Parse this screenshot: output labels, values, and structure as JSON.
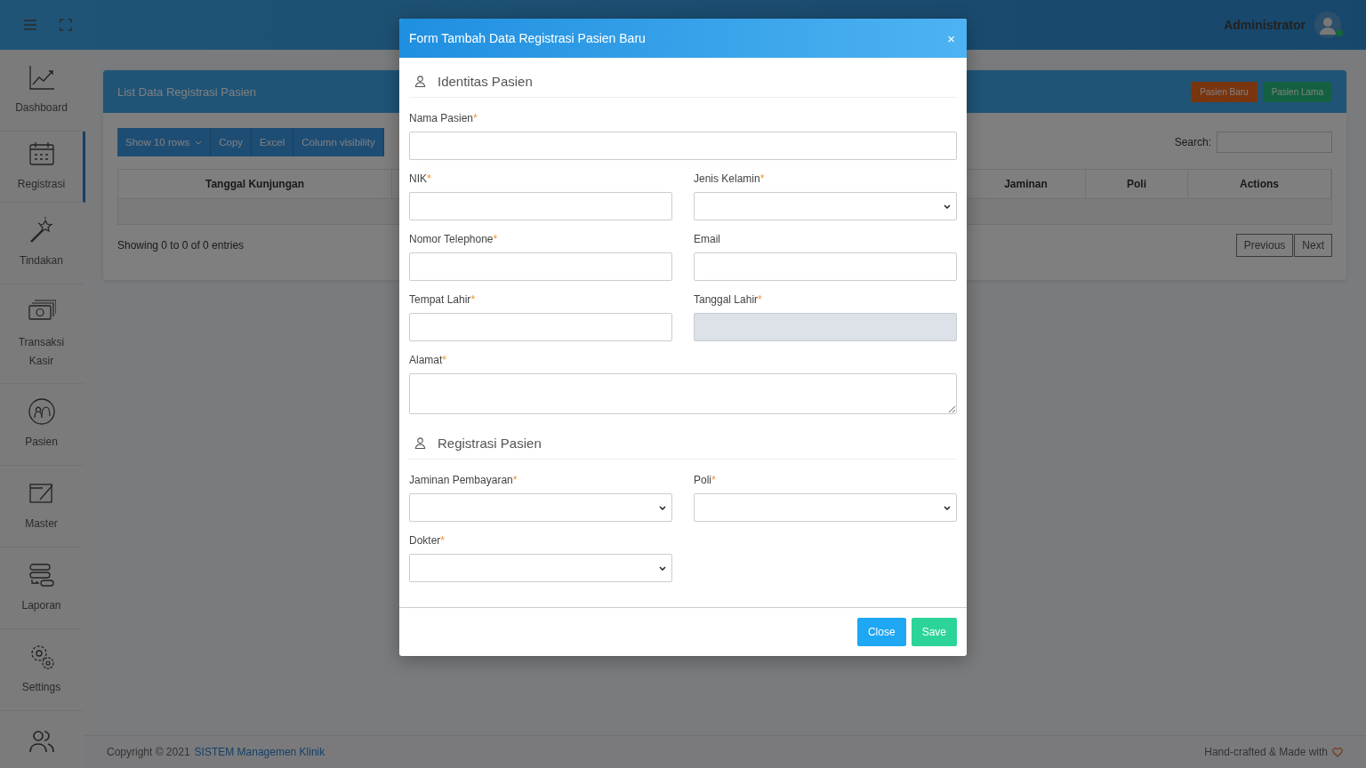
{
  "header": {
    "user": "Administrator"
  },
  "sidebar": {
    "items": [
      {
        "label": "Dashboard",
        "selected": false
      },
      {
        "label": "Registrasi",
        "selected": true
      },
      {
        "label": "Tindakan",
        "selected": false
      },
      {
        "label": "Transaksi Kasir",
        "selected": false
      },
      {
        "label": "Pasien",
        "selected": false
      },
      {
        "label": "Master",
        "selected": false
      },
      {
        "label": "Laporan",
        "selected": false
      },
      {
        "label": "Settings",
        "selected": false
      },
      {
        "selected": false
      }
    ]
  },
  "card": {
    "title": "List Data Registrasi Pasien",
    "actions": [
      "Pasien Baru",
      "Pasien Lama"
    ],
    "toolbar": [
      "Show 10 rows",
      "Copy",
      "Excel",
      "Column visibility"
    ],
    "search_label": "Search:",
    "columns": [
      "Tanggal Kunjungan",
      "Jaminan",
      "Poli",
      "Actions"
    ],
    "info": "Showing 0 to 0 of 0 entries",
    "pager": [
      "Previous",
      "Next"
    ]
  },
  "footer": {
    "copyright": "Copyright © 2021",
    "link": "SISTEM Managemen Klinik",
    "credit": "Hand-crafted & Made with"
  },
  "modal": {
    "title": "Form Tambah Data Registrasi Pasien Baru",
    "close": "×",
    "sections": [
      {
        "title": "Identitas Pasien",
        "fields": [
          {
            "label": "Nama Pasien",
            "required_mark": "*",
            "kind": "text",
            "wide": true,
            "disabled": false
          },
          {
            "label": "NIK",
            "required_mark": "*",
            "kind": "text",
            "wide": false,
            "disabled": false
          },
          {
            "label": "Jenis Kelamin",
            "required_mark": "*",
            "kind": "select",
            "wide": false,
            "disabled": false
          },
          {
            "label": "Nomor Telephone",
            "required_mark": "*",
            "kind": "text",
            "wide": false,
            "disabled": false
          },
          {
            "label": "Email",
            "kind": "text",
            "wide": false,
            "disabled": false
          },
          {
            "label": "Tempat Lahir",
            "required_mark": "*",
            "kind": "text",
            "wide": false,
            "disabled": false
          },
          {
            "label": "Tanggal Lahir",
            "required_mark": "*",
            "kind": "text",
            "wide": false,
            "disabled": true
          },
          {
            "label": "Alamat",
            "required_mark": "*",
            "kind": "textarea",
            "wide": true,
            "disabled": false
          }
        ]
      },
      {
        "title": "Registrasi Pasien",
        "fields": [
          {
            "label": "Jaminan Pembayaran",
            "required_mark": "*",
            "kind": "select",
            "wide": false,
            "disabled": false
          },
          {
            "label": "Poli",
            "required_mark": "*",
            "kind": "select",
            "wide": false,
            "disabled": false
          },
          {
            "label": "Dokter",
            "required_mark": "*",
            "kind": "select",
            "wide": false,
            "disabled": false
          }
        ]
      }
    ],
    "buttons": [
      {
        "label": "Close",
        "kind": "secondary"
      },
      {
        "label": "Save",
        "kind": "primary"
      }
    ]
  }
}
